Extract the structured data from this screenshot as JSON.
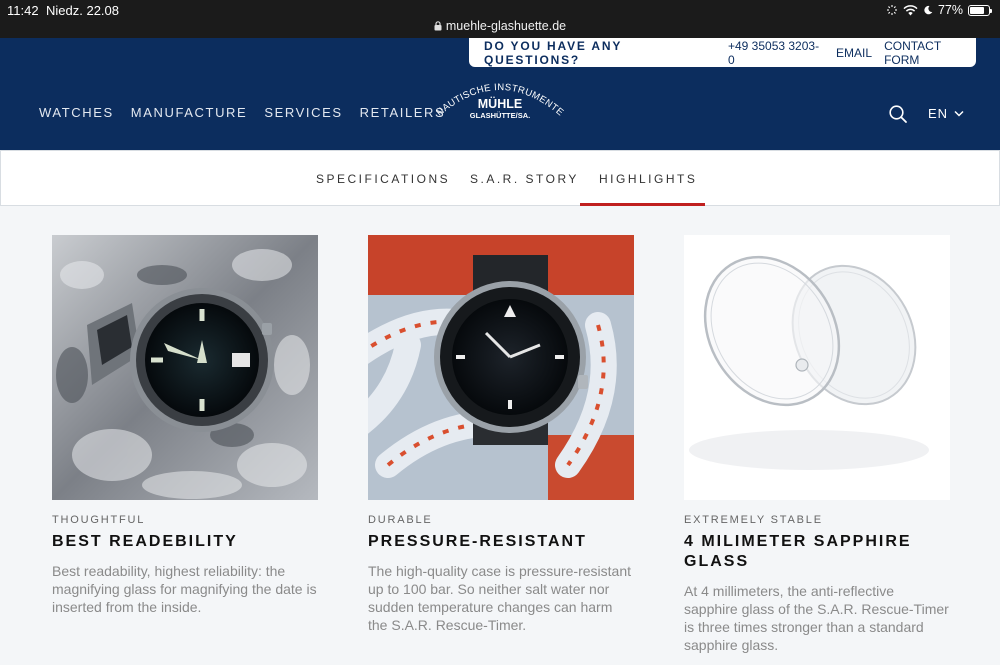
{
  "status_bar": {
    "time": "11:42",
    "date": "Niedz. 22.08",
    "url": "muehle-glashuette.de",
    "battery": "77%",
    "battery_level": 0.77
  },
  "topbar": {
    "question": "DO YOU HAVE ANY QUESTIONS?",
    "phone": "+49 35053 3203-0",
    "email": "EMAIL",
    "contact": "CONTACT FORM"
  },
  "nav": {
    "items": [
      "WATCHES",
      "MANUFACTURE",
      "SERVICES",
      "RETAILERS"
    ],
    "language": "EN"
  },
  "logo": {
    "arc_text": "NAUTISCHE INSTRUMENTE",
    "name": "MÜHLE",
    "sub": "GLASHÜTTE/SA."
  },
  "tabs": {
    "items": [
      "SPECIFICATIONS",
      "S.A.R. STORY",
      "HIGHLIGHTS"
    ],
    "active": "HIGHLIGHTS"
  },
  "cards": [
    {
      "eyebrow": "THOUGHTFUL",
      "title": "BEST READEBILITY",
      "desc": "Best readability, highest reliability: the magnifying glass for magnifying the date is inserted from the inside."
    },
    {
      "eyebrow": "DURABLE",
      "title": "PRESSURE-RESISTANT",
      "desc": "The high-quality case is pressure-resistant up to 100 bar. So neither salt water nor sudden temperature changes can harm the S.A.R. Rescue-Timer."
    },
    {
      "eyebrow": "EXTREMELY STABLE",
      "title": "4 MILIMETER SAPPHIRE GLASS",
      "desc": "At 4 millimeters, the anti-reflective sapphire glass of the S.A.R. Rescue-Timer is three times stronger than a standard sapphire glass."
    }
  ],
  "colors": {
    "header_bg": "#0c2d5e",
    "accent_red": "#c0201f",
    "page_bg": "#f4f6f8"
  }
}
